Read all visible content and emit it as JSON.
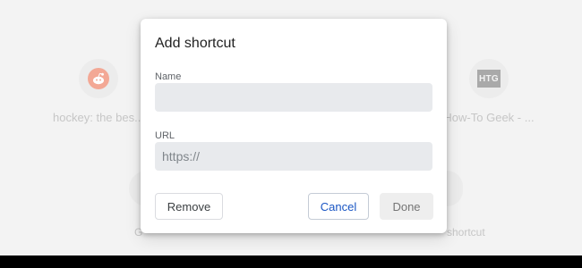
{
  "background": {
    "tiles": [
      {
        "title": "hockey: the bes...",
        "icon": "reddit-icon"
      },
      {
        "title": "How-To Geek - ...",
        "icon": "htg-icon",
        "icon_text": "HTG"
      },
      {
        "title": "G...",
        "icon": "google-icon"
      },
      {
        "title": "Add shortcut",
        "icon": "add-icon"
      }
    ]
  },
  "dialog": {
    "title": "Add shortcut",
    "name_label": "Name",
    "name_value": "",
    "url_label": "URL",
    "url_placeholder": "https://",
    "remove_label": "Remove",
    "cancel_label": "Cancel",
    "done_label": "Done"
  },
  "colors": {
    "accent": "#1a56c4",
    "field_bg": "#e8eaed",
    "page_bg": "#f3f3f3"
  }
}
